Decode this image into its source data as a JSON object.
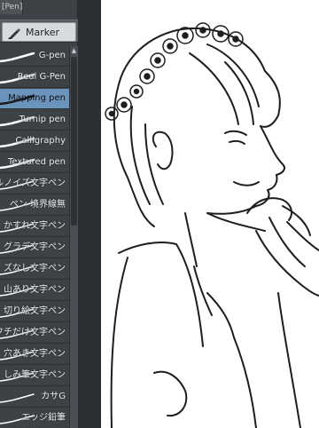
{
  "panel": {
    "tab_label": "[Pen]",
    "marker_label": "Marker"
  },
  "brushes": [
    {
      "label": "G-pen",
      "selected": false
    },
    {
      "label": "Real G-Pen",
      "selected": false
    },
    {
      "label": "Mapping pen",
      "selected": true
    },
    {
      "label": "Turnip pen",
      "selected": false
    },
    {
      "label": "Calligraphy",
      "selected": false
    },
    {
      "label": "Textured pen",
      "selected": false
    },
    {
      "label": "ルノイズ文字ペン",
      "selected": false
    },
    {
      "label": "ペン 境界線無",
      "selected": false
    },
    {
      "label": "かすれ文字ペン",
      "selected": false
    },
    {
      "label": "グラデ文字ペン",
      "selected": false
    },
    {
      "label": "ズなし文字ペン",
      "selected": false
    },
    {
      "label": "山あり文字ペン",
      "selected": false
    },
    {
      "label": "切り絵文字ペン",
      "selected": false
    },
    {
      "label": "フチだけ文字ペン",
      "selected": false
    },
    {
      "label": "穴あき文字ペン",
      "selected": false
    },
    {
      "label": "しみ筆文字ペン",
      "selected": false
    },
    {
      "label": "カサG",
      "selected": false
    },
    {
      "label": "エッジ鉛筆",
      "selected": false
    }
  ],
  "colors": {
    "panel_bg": "#3d4247",
    "selected_bg": "#6b94bd",
    "canvas_bg": "#ffffff",
    "line_art": "#1e1e1e"
  }
}
